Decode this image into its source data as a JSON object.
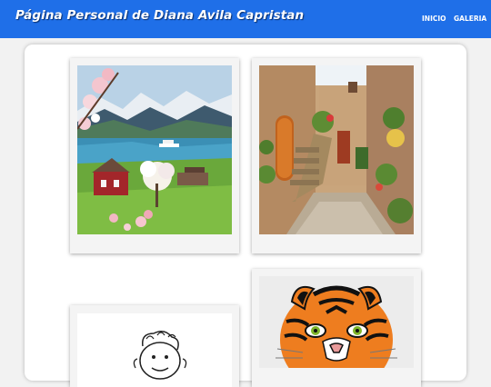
{
  "header": {
    "title": "Página Personal de Diana Avila Capristan",
    "nav": [
      {
        "label": "INICIO"
      },
      {
        "label": "GALERIA"
      }
    ]
  },
  "gallery": [
    {
      "subject": "fjord-landscape-photo"
    },
    {
      "subject": "stone-village-alley-photo"
    },
    {
      "subject": "cartoon-face-drawing"
    },
    {
      "subject": "tiger-illustration"
    }
  ],
  "colors": {
    "header_bg": "#1f6fe8",
    "page_bg": "#f2f2f2",
    "panel_bg": "#ffffff"
  }
}
